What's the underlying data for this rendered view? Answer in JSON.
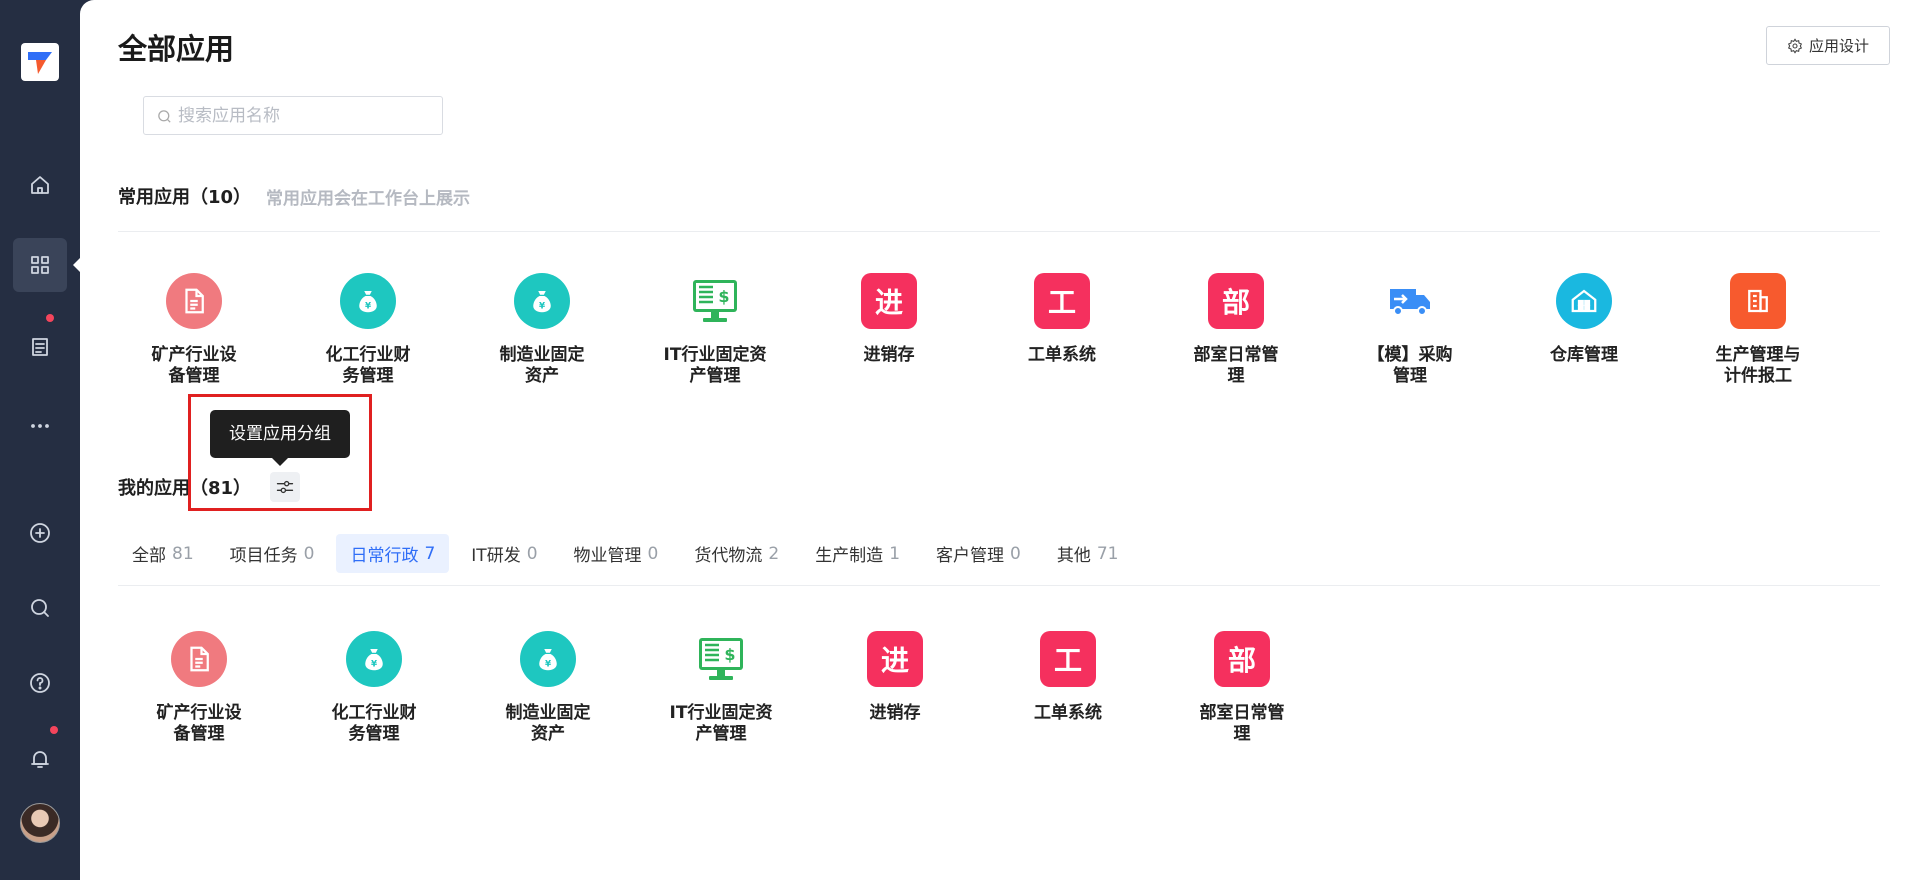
{
  "colors": {
    "sidebar_bg": "#252e42",
    "accent": "#2f6ef7",
    "red": "#e02020"
  },
  "page": {
    "title": "全部应用",
    "design_button": "应用设计"
  },
  "search": {
    "placeholder": "搜索应用名称",
    "value": ""
  },
  "common": {
    "title": "常用应用（10）",
    "subtitle": "常用应用会在工作台上展示",
    "apps": [
      {
        "label": "矿产行业设\n备管理",
        "icon": "document-icon",
        "color": "#f07a7f"
      },
      {
        "label": "化工行业财\n务管理",
        "icon": "money-bag-icon",
        "color": "#1ec7c0"
      },
      {
        "label": "制造业固定\n资产",
        "icon": "money-bag-icon",
        "color": "#1ec7c0"
      },
      {
        "label": "IT行业固定资\n产管理",
        "icon": "monitor-dollar-icon",
        "color": "#2fb45a"
      },
      {
        "label": "进销存",
        "icon": "进",
        "color": "#f5305e"
      },
      {
        "label": "工单系统",
        "icon": "工",
        "color": "#f5305e"
      },
      {
        "label": "部室日常管\n理",
        "icon": "部",
        "color": "#f5305e"
      },
      {
        "label": "【模】采购\n管理",
        "icon": "delivery-truck-icon",
        "color": "#3a8ef6"
      },
      {
        "label": "仓库管理",
        "icon": "warehouse-icon",
        "color": "#1ab8e0"
      },
      {
        "label": "生产管理与\n计件报工",
        "icon": "building-icon",
        "color": "#f75a2e"
      }
    ]
  },
  "mine": {
    "title": "我的应用（81）",
    "tooltip": "设置应用分组",
    "tabs": [
      {
        "label": "全部",
        "count": "81"
      },
      {
        "label": "项目任务",
        "count": "0"
      },
      {
        "label": "日常行政",
        "count": "7",
        "active": true
      },
      {
        "label": "IT研发",
        "count": "0"
      },
      {
        "label": "物业管理",
        "count": "0"
      },
      {
        "label": "货代物流",
        "count": "2"
      },
      {
        "label": "生产制造",
        "count": "1"
      },
      {
        "label": "客户管理",
        "count": "0"
      },
      {
        "label": "其他",
        "count": "71"
      }
    ],
    "apps": [
      {
        "label": "矿产行业设\n备管理",
        "icon": "document-icon",
        "color": "#f07a7f"
      },
      {
        "label": "化工行业财\n务管理",
        "icon": "money-bag-icon",
        "color": "#1ec7c0"
      },
      {
        "label": "制造业固定\n资产",
        "icon": "money-bag-icon",
        "color": "#1ec7c0"
      },
      {
        "label": "IT行业固定资\n产管理",
        "icon": "monitor-dollar-icon",
        "color": "#2fb45a"
      },
      {
        "label": "进销存",
        "icon": "进",
        "color": "#f5305e"
      },
      {
        "label": "工单系统",
        "icon": "工",
        "color": "#f5305e"
      },
      {
        "label": "部室日常管\n理",
        "icon": "部",
        "color": "#f5305e"
      }
    ]
  }
}
